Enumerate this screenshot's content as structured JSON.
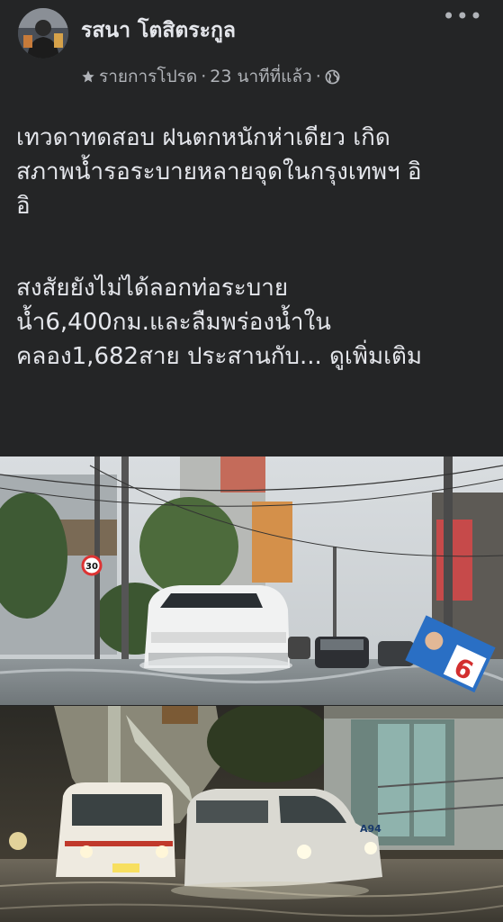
{
  "post": {
    "author": "รสนา โตสิตระกูล",
    "more_label": "•••",
    "meta": {
      "favorites_label": "รายการโปรด",
      "separator": "·",
      "time": "23 นาทีที่แล้ว",
      "privacy_icon": "globe-icon"
    },
    "text": {
      "line1": "เทวดาทดสอบ ฝนตกหนักห่าเดียว เกิด",
      "line2": "สภาพน้ำรอระบายหลายจุดในกรุงเทพฯ อิ",
      "line3": "อิ",
      "line4": "สงสัยยังไม่ได้ลอกท่อระบาย",
      "line5": "น้ำ6,400กม.และลืมพร่องน้ำใน",
      "line6": "คลอง1,682สาย ประสานกับ...",
      "see_more": "ดูเพิ่มเติม"
    }
  },
  "photo1": {
    "speed_sign": "30",
    "poster_number": "6"
  },
  "photo2": {
    "van_plate": "A94"
  },
  "colors": {
    "background": "#242526",
    "text": "#e4e6eb",
    "muted": "#b0b3b8"
  }
}
